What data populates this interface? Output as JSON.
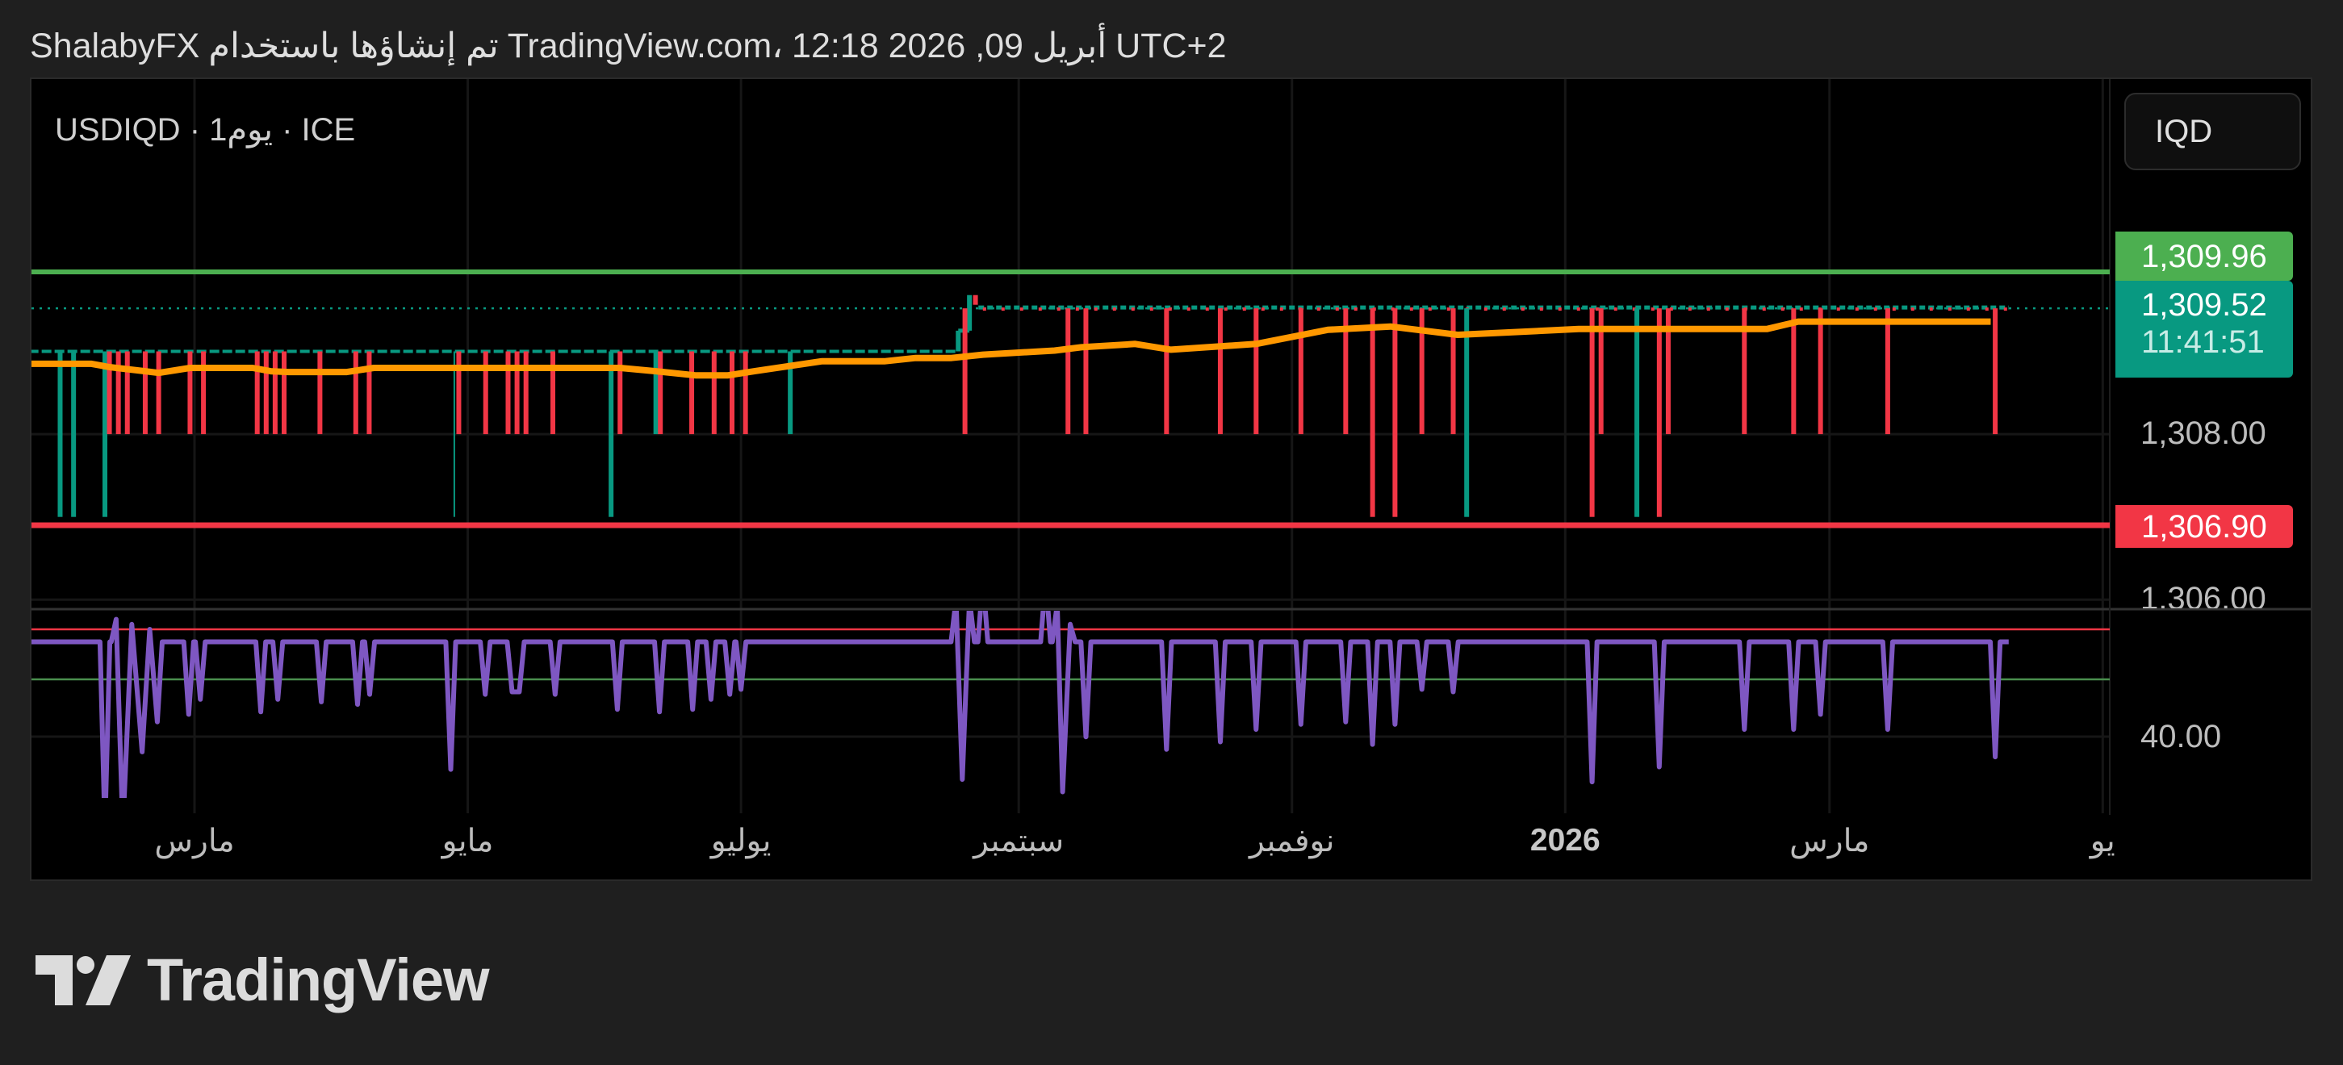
{
  "header": {
    "parts": [
      "ShalabyFX",
      "تم إنشاؤها باستخدام",
      "TradingView.com،",
      "12:18 2026 ,09",
      "أبريل",
      "UTC+2"
    ]
  },
  "symbol": {
    "ticker": "USDIQD",
    "sep": "·",
    "interval_num": "1",
    "interval_unit": "يوم",
    "exchange": "ICE"
  },
  "currency_button": "IQD",
  "price_labels": {
    "resistance": "1,309.96",
    "last_price": "1,309.52",
    "countdown": "11:41:51",
    "support": "1,306.90"
  },
  "axis_labels": {
    "p1308": "1,308.00",
    "p1306": "1,306.00",
    "ind40": "40.00"
  },
  "time_labels": [
    {
      "label": "مارس",
      "day": 0,
      "bold": false
    },
    {
      "label": "مايو",
      "day": 61,
      "bold": false
    },
    {
      "label": "يوليو",
      "day": 122,
      "bold": false
    },
    {
      "label": "سبتمبر",
      "day": 184,
      "bold": false
    },
    {
      "label": "نوفمبر",
      "day": 245,
      "bold": false
    },
    {
      "label": "2026",
      "day": 306,
      "bold": true
    },
    {
      "label": "مارس",
      "day": 365,
      "bold": false
    },
    {
      "label": "يو",
      "day": 426,
      "bold": false
    }
  ],
  "logo_text": "TradingView",
  "colors": {
    "green": "#4caf50",
    "teal": "#089981",
    "red": "#f23645",
    "orange": "#ff9800",
    "purple": "#7e57c2",
    "grid": "#161616"
  },
  "chart_data": {
    "type": "candlestick",
    "x_unit": "days since 2025-03-01",
    "x_range": [
      -37,
      426
    ],
    "price_range": [
      1305.85,
      1310.5
    ],
    "price_ticks": [
      1308,
      1306
    ],
    "levels": {
      "resistance": 1309.96,
      "support": 1306.9,
      "last": 1309.52
    },
    "flat_close_early": 1309.0,
    "flat_close_late": 1309.52,
    "step_up": [
      [
        171,
        1309.25
      ],
      [
        173,
        1309.68
      ],
      [
        176,
        1309.55
      ]
    ],
    "spikes": [
      {
        "d": -30,
        "low": 1307.0,
        "c": "g"
      },
      {
        "d": -27,
        "low": 1307.0,
        "c": "g"
      },
      {
        "d": -20,
        "low": 1307.0,
        "c": "g"
      },
      {
        "d": -19,
        "low": 1308.0,
        "c": "r"
      },
      {
        "d": -17,
        "low": 1308.0,
        "c": "r"
      },
      {
        "d": -15,
        "low": 1308.0,
        "c": "r"
      },
      {
        "d": -11,
        "low": 1308.0,
        "c": "r"
      },
      {
        "d": -8,
        "low": 1308.0,
        "c": "r"
      },
      {
        "d": -1,
        "low": 1308.0,
        "c": "r"
      },
      {
        "d": 2,
        "low": 1308.0,
        "c": "r"
      },
      {
        "d": 14,
        "low": 1308.0,
        "c": "r"
      },
      {
        "d": 16,
        "low": 1308.0,
        "c": "r"
      },
      {
        "d": 18,
        "low": 1308.0,
        "c": "r"
      },
      {
        "d": 20,
        "low": 1308.0,
        "c": "r"
      },
      {
        "d": 28,
        "low": 1308.0,
        "c": "r"
      },
      {
        "d": 36,
        "low": 1308.0,
        "c": "r"
      },
      {
        "d": 39,
        "low": 1308.0,
        "c": "r"
      },
      {
        "d": 58,
        "low": 1307.0,
        "c": "g",
        "thin": true
      },
      {
        "d": 59,
        "low": 1308.0,
        "c": "r"
      },
      {
        "d": 65,
        "low": 1308.0,
        "c": "r"
      },
      {
        "d": 70,
        "low": 1308.0,
        "c": "r"
      },
      {
        "d": 72,
        "low": 1308.0,
        "c": "r"
      },
      {
        "d": 74,
        "low": 1308.0,
        "c": "r"
      },
      {
        "d": 80,
        "low": 1308.0,
        "c": "r"
      },
      {
        "d": 93,
        "low": 1307.0,
        "c": "g"
      },
      {
        "d": 95,
        "low": 1308.0,
        "c": "r"
      },
      {
        "d": 103,
        "low": 1308.0,
        "c": "g"
      },
      {
        "d": 104,
        "low": 1308.0,
        "c": "r"
      },
      {
        "d": 111,
        "low": 1308.0,
        "c": "r"
      },
      {
        "d": 116,
        "low": 1308.0,
        "c": "r"
      },
      {
        "d": 120,
        "low": 1308.0,
        "c": "r"
      },
      {
        "d": 123,
        "low": 1308.0,
        "c": "r"
      },
      {
        "d": 133,
        "low": 1308.0,
        "c": "g"
      },
      {
        "d": 172,
        "low": 1308.0,
        "c": "r"
      },
      {
        "d": 195,
        "low": 1308.0,
        "c": "r"
      },
      {
        "d": 199,
        "low": 1308.0,
        "c": "r"
      },
      {
        "d": 217,
        "low": 1308.0,
        "c": "r"
      },
      {
        "d": 229,
        "low": 1308.0,
        "c": "r"
      },
      {
        "d": 237,
        "low": 1308.0,
        "c": "r"
      },
      {
        "d": 247,
        "low": 1308.0,
        "c": "r"
      },
      {
        "d": 257,
        "low": 1308.0,
        "c": "r"
      },
      {
        "d": 263,
        "low": 1307.0,
        "c": "r"
      },
      {
        "d": 268,
        "low": 1307.0,
        "c": "r"
      },
      {
        "d": 274,
        "low": 1308.0,
        "c": "r"
      },
      {
        "d": 281,
        "low": 1308.0,
        "c": "r"
      },
      {
        "d": 284,
        "low": 1307.0,
        "c": "g"
      },
      {
        "d": 312,
        "low": 1307.0,
        "c": "r"
      },
      {
        "d": 314,
        "low": 1308.0,
        "c": "r"
      },
      {
        "d": 322,
        "low": 1307.0,
        "c": "g"
      },
      {
        "d": 327,
        "low": 1307.0,
        "c": "r"
      },
      {
        "d": 329,
        "low": 1308.0,
        "c": "r"
      },
      {
        "d": 346,
        "low": 1308.0,
        "c": "r"
      },
      {
        "d": 357,
        "low": 1308.0,
        "c": "r"
      },
      {
        "d": 363,
        "low": 1308.0,
        "c": "r"
      },
      {
        "d": 378,
        "low": 1308.0,
        "c": "r"
      },
      {
        "d": 402,
        "low": 1308.0,
        "c": "r"
      }
    ],
    "moving_average": [
      [
        -37,
        1308.85
      ],
      [
        -23,
        1308.85
      ],
      [
        -19,
        1308.81
      ],
      [
        -11,
        1308.76
      ],
      [
        -8,
        1308.74
      ],
      [
        -1,
        1308.8
      ],
      [
        13,
        1308.8
      ],
      [
        17,
        1308.76
      ],
      [
        21,
        1308.75
      ],
      [
        34,
        1308.75
      ],
      [
        40,
        1308.8
      ],
      [
        95,
        1308.8
      ],
      [
        103,
        1308.76
      ],
      [
        112,
        1308.71
      ],
      [
        119,
        1308.71
      ],
      [
        125,
        1308.76
      ],
      [
        140,
        1308.88
      ],
      [
        154,
        1308.88
      ],
      [
        161,
        1308.92
      ],
      [
        169,
        1308.92
      ],
      [
        176,
        1308.96
      ],
      [
        192,
        1309.01
      ],
      [
        198,
        1309.05
      ],
      [
        210,
        1309.09
      ],
      [
        218,
        1309.02
      ],
      [
        237,
        1309.09
      ],
      [
        253,
        1309.26
      ],
      [
        267,
        1309.3
      ],
      [
        282,
        1309.2
      ],
      [
        309,
        1309.27
      ],
      [
        351,
        1309.27
      ],
      [
        358,
        1309.36
      ],
      [
        401,
        1309.36
      ]
    ],
    "indicator": {
      "levels": [
        80,
        60
      ],
      "tick": 40,
      "baseline": 75,
      "range_days": [
        -37,
        405
      ],
      "points": [
        [
          -20,
          0
        ],
        [
          -17.5,
          84
        ],
        [
          -16,
          0
        ],
        [
          -14,
          82
        ],
        [
          -11.7,
          31
        ],
        [
          -10,
          80
        ],
        [
          -8.3,
          43
        ],
        [
          -1.3,
          46
        ],
        [
          1.3,
          52
        ],
        [
          14.8,
          47
        ],
        [
          18.6,
          52
        ],
        [
          28.3,
          51
        ],
        [
          36.4,
          50
        ],
        [
          39.1,
          54
        ],
        [
          57.2,
          24
        ],
        [
          64.9,
          54
        ],
        [
          70.9,
          55
        ],
        [
          72.5,
          55
        ],
        [
          80.5,
          54
        ],
        [
          94.4,
          48
        ],
        [
          103.8,
          47
        ],
        [
          111.2,
          48
        ],
        [
          115.3,
          52
        ],
        [
          119.5,
          54
        ],
        [
          122,
          56
        ],
        [
          170,
          92
        ],
        [
          171.4,
          20
        ],
        [
          173,
          92
        ],
        [
          176,
          100
        ],
        [
          190,
          100
        ],
        [
          192.6,
          90
        ],
        [
          193.8,
          15
        ],
        [
          195.5,
          82
        ],
        [
          199,
          37
        ],
        [
          217,
          32
        ],
        [
          229,
          35
        ],
        [
          237,
          40
        ],
        [
          247,
          42
        ],
        [
          257,
          43
        ],
        [
          263,
          34
        ],
        [
          268,
          42
        ],
        [
          274,
          56
        ],
        [
          281,
          55
        ],
        [
          312,
          19
        ],
        [
          327,
          25
        ],
        [
          346,
          40
        ],
        [
          357,
          40
        ],
        [
          363,
          46
        ],
        [
          378,
          40
        ],
        [
          402,
          29
        ]
      ]
    }
  }
}
